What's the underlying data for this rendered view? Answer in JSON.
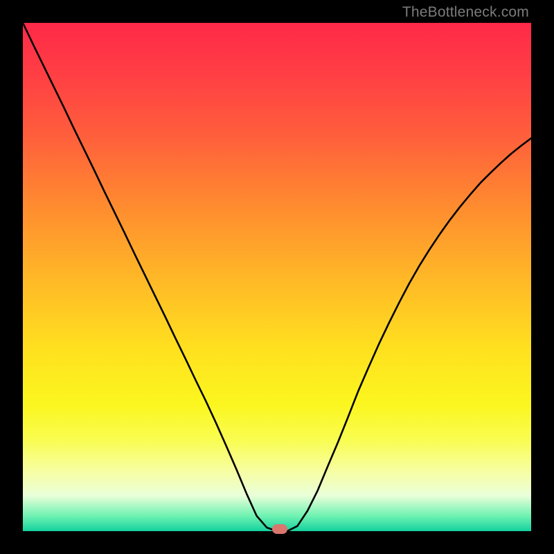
{
  "watermark": {
    "text": "TheBottleneck.com"
  },
  "colors": {
    "frame": "#000000",
    "curve": "#000000",
    "marker": "#d9766e",
    "watermark": "#7c7c7c",
    "gradient_stops": [
      "#ff2948",
      "#ff3e44",
      "#ff5e3c",
      "#ff8b2f",
      "#ffb727",
      "#ffe01f",
      "#fbf61f",
      "#f9fd50",
      "#f7fea0",
      "#eaffd9",
      "#6ff2b2",
      "#14d19e"
    ]
  },
  "chart_data": {
    "type": "line",
    "title": "",
    "xlabel": "",
    "ylabel": "",
    "xlim": [
      0,
      1
    ],
    "ylim": [
      0,
      1
    ],
    "x": [
      0.0,
      0.02,
      0.04,
      0.06,
      0.08,
      0.1,
      0.12,
      0.14,
      0.16,
      0.18,
      0.2,
      0.22,
      0.24,
      0.26,
      0.28,
      0.3,
      0.32,
      0.34,
      0.36,
      0.38,
      0.4,
      0.42,
      0.44,
      0.46,
      0.48,
      0.5,
      0.52,
      0.54,
      0.56,
      0.58,
      0.6,
      0.62,
      0.64,
      0.66,
      0.68,
      0.7,
      0.72,
      0.74,
      0.76,
      0.78,
      0.8,
      0.82,
      0.84,
      0.86,
      0.88,
      0.9,
      0.92,
      0.94,
      0.96,
      0.98,
      1.0
    ],
    "values": [
      1.0,
      0.958,
      0.917,
      0.876,
      0.835,
      0.793,
      0.752,
      0.711,
      0.669,
      0.628,
      0.587,
      0.545,
      0.504,
      0.463,
      0.422,
      0.38,
      0.339,
      0.297,
      0.256,
      0.213,
      0.168,
      0.122,
      0.074,
      0.03,
      0.007,
      0.0,
      0.0,
      0.01,
      0.04,
      0.08,
      0.128,
      0.175,
      0.225,
      0.276,
      0.322,
      0.367,
      0.409,
      0.449,
      0.487,
      0.522,
      0.554,
      0.584,
      0.612,
      0.638,
      0.662,
      0.685,
      0.705,
      0.724,
      0.742,
      0.758,
      0.773
    ],
    "minimum_point": {
      "x": 0.505,
      "y": 0.0
    },
    "marker": {
      "x": 0.505,
      "y": 0.0
    }
  }
}
